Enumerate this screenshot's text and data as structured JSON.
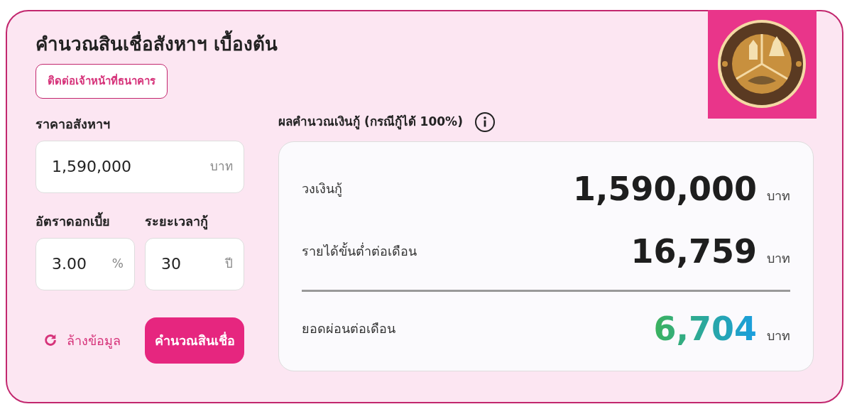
{
  "title": "คำนวณสินเชื่อสังหาฯ เบื้องต้น",
  "contact_button": "ติดต่อเจ้าหน้าที่ธนาคาร",
  "price": {
    "label": "ราคาอสังหาฯ",
    "value": "1,590,000",
    "unit": "บาท"
  },
  "rate": {
    "label": "อัตราดอกเบี้ย",
    "value": "3.00",
    "unit": "%"
  },
  "term": {
    "label": "ระยะเวลากู้",
    "value": "30",
    "unit": "ปี"
  },
  "reset_button": "ล้างข้อมูล",
  "calculate_button": "คำนวณสินเชื่อ",
  "results": {
    "heading": "ผลคำนวณเงินกู้ (กรณีกู้ได้ 100%)",
    "rows": [
      {
        "kind": "plain",
        "label": "วงเงินกู้",
        "value": "1,590,000",
        "unit": "บาท"
      },
      {
        "kind": "plain",
        "label": "รายได้ขั้นต่ำต่อเดือน",
        "value": "16,759",
        "unit": "บาท"
      },
      {
        "kind": "highlight",
        "label": "ยอดผ่อนต่อเดือน",
        "value": "6,704",
        "unit": "บาท"
      }
    ]
  }
}
